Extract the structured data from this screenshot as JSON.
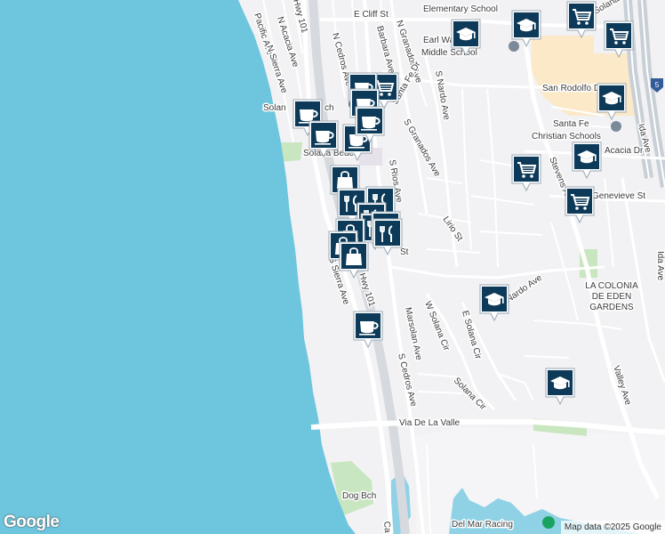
{
  "map": {
    "water_color": "#6dc6de",
    "land_color": "#f2f1f4",
    "road_color": "#ffffff",
    "highway_color": "#c8cfd6",
    "school_color": "#fbe9c8",
    "park_color": "#c8e6c0",
    "pin_color": "#0c3a58"
  },
  "labels": {
    "e_cliff_st": "E Cliff St",
    "elementary_school": "Elementary School",
    "earl_warren": "Earl Warren",
    "middle_school": "Middle School",
    "pacific_ave": "Pacific Ave",
    "hwy_101_n": "Hwy 101",
    "n_acacia_ave": "N Acacia Ave",
    "n_sierra_ave": "N Sierra Ave",
    "n_cedros_ave": "N Cedros Ave",
    "barbara_ave": "Barbara Ave",
    "n_granados_ave": "N Granados Ave",
    "santa_fe_dr": "Santa Fe Dr",
    "s_nardo_ave": "S Nardo Ave",
    "s_granados_ave": "S Granados Ave",
    "san_rodolfo_dr": "San Rodolfo Dr",
    "santa_fe": "Santa Fe",
    "christian_schools": "Christian Schools",
    "solana_beach": "Solana Beach",
    "solana_beach_partial": "Solan",
    "solana_beach_partial2": "ch",
    "solana_beach_center": "Solana Beach",
    "s_rios_ave": "S Rios Ave",
    "acacia_dr": "Acacia Dr",
    "genevieve_st": "Genevieve St",
    "ida_ave_n": "Ida Ave",
    "ida_ave_s": "Ida Ave",
    "stevens_ave": "Stevens Ave",
    "lirio_st": "Lirio St",
    "st": "St",
    "s_sierra_ave": "S Sierra Ave",
    "hwy_101_s": "Hwy 101",
    "nardo_ave": "Nardo Ave",
    "la_colonia_line1": "LA COLONIA",
    "la_colonia_line2": "DE EDEN",
    "la_colonia_line3": "GARDENS",
    "marsolan_ave": "Marsolan Ave",
    "w_solana_cir": "W Solana Cir",
    "e_solana_cir": "E Solana Cir",
    "s_cedros_ave": "S Cedros Ave",
    "solana_cir": "Solana Cir",
    "valley_ave": "Valley Ave",
    "via_de_la_valle": "Via De La Valle",
    "dog_bch": "Dog Bch",
    "del_mar_racing": "Del Mar Racing",
    "ca": "Ca",
    "highway_5": "5",
    "solana_hills": "Solana"
  },
  "pins": [
    {
      "type": "school",
      "icon": "graduation-cap-icon"
    },
    {
      "type": "school",
      "icon": "graduation-cap-icon"
    },
    {
      "type": "grocery",
      "icon": "shopping-cart-icon"
    },
    {
      "type": "grocery",
      "icon": "shopping-cart-icon"
    },
    {
      "type": "school",
      "icon": "graduation-cap-icon"
    },
    {
      "type": "cafe",
      "icon": "coffee-cup-icon"
    },
    {
      "type": "cafe",
      "icon": "coffee-cup-icon"
    },
    {
      "type": "cafe",
      "icon": "coffee-cup-icon"
    },
    {
      "type": "grocery",
      "icon": "shopping-cart-icon"
    },
    {
      "type": "cafe",
      "icon": "coffee-cup-icon"
    },
    {
      "type": "cafe",
      "icon": "coffee-cup-icon"
    },
    {
      "type": "cafe",
      "icon": "coffee-cup-icon"
    },
    {
      "type": "school",
      "icon": "graduation-cap-icon"
    },
    {
      "type": "grocery",
      "icon": "shopping-cart-icon"
    },
    {
      "type": "grocery",
      "icon": "shopping-cart-icon"
    },
    {
      "type": "shopping",
      "icon": "shopping-bag-icon"
    },
    {
      "type": "restaurant",
      "icon": "fork-knife-icon"
    },
    {
      "type": "restaurant",
      "icon": "fork-knife-icon"
    },
    {
      "type": "restaurant",
      "icon": "fork-knife-icon"
    },
    {
      "type": "restaurant",
      "icon": "fork-knife-icon"
    },
    {
      "type": "restaurant",
      "icon": "fork-knife-icon"
    },
    {
      "type": "restaurant",
      "icon": "fork-knife-icon"
    },
    {
      "type": "shopping",
      "icon": "shopping-bag-icon"
    },
    {
      "type": "shopping",
      "icon": "shopping-bag-icon"
    },
    {
      "type": "shopping",
      "icon": "shopping-bag-icon"
    },
    {
      "type": "school",
      "icon": "graduation-cap-icon"
    },
    {
      "type": "cafe",
      "icon": "coffee-cup-icon"
    },
    {
      "type": "school",
      "icon": "graduation-cap-icon"
    }
  ],
  "attribution": {
    "logo": "Google",
    "text": "Map data ©2025 Google"
  }
}
